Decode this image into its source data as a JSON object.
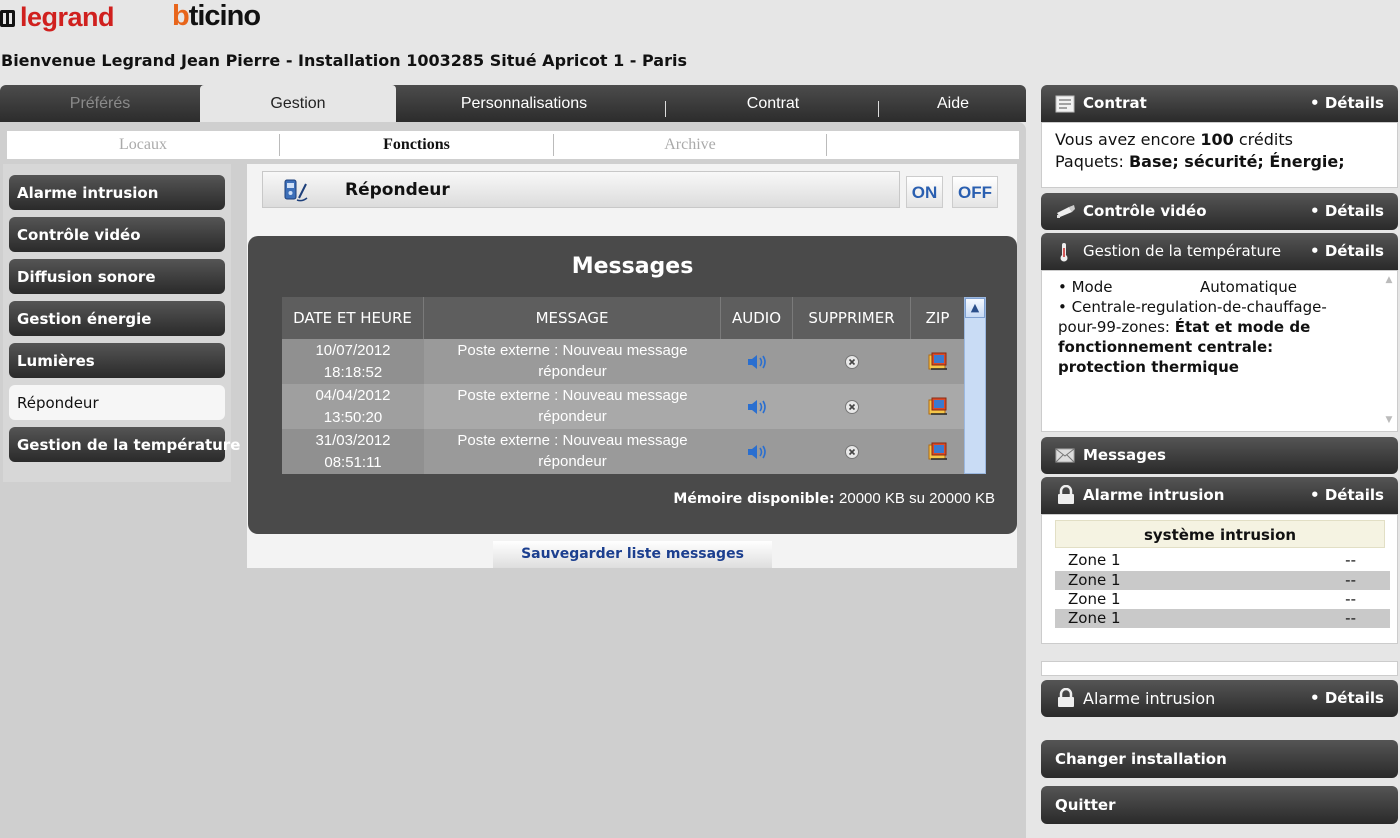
{
  "header": {
    "logo_legrand": "legrand",
    "logo_bticino": "bticino",
    "welcome": "Bienvenue Legrand Jean Pierre - Installation 1003285 Situé Apricot 1 - Paris"
  },
  "main_tabs": [
    {
      "label": "Préférés"
    },
    {
      "label": "Gestion"
    },
    {
      "label": "Personnalisations"
    },
    {
      "label": "Contrat"
    },
    {
      "label": "Aide"
    }
  ],
  "sub_tabs": [
    {
      "label": "Locaux"
    },
    {
      "label": "Fonctions"
    },
    {
      "label": "Archive"
    }
  ],
  "left_nav": [
    {
      "label": "Alarme intrusion"
    },
    {
      "label": "Contrôle vidéo"
    },
    {
      "label": "Diffusion sonore"
    },
    {
      "label": "Gestion énergie"
    },
    {
      "label": "Lumières"
    },
    {
      "label": "Répondeur"
    },
    {
      "label": "Gestion de la température"
    }
  ],
  "function_bar": {
    "title": "Répondeur",
    "on": "ON",
    "off": "OFF"
  },
  "messages": {
    "title": "Messages",
    "columns": [
      "DATE ET HEURE",
      "MESSAGE",
      "AUDIO",
      "SUPPRIMER",
      "ZIP"
    ],
    "rows": [
      {
        "date": "10/07/2012",
        "time": "18:18:52",
        "msg1": "Poste externe : Nouveau message",
        "msg2": "répondeur"
      },
      {
        "date": "04/04/2012",
        "time": "13:50:20",
        "msg1": "Poste externe : Nouveau message",
        "msg2": "répondeur"
      },
      {
        "date": "31/03/2012",
        "time": "08:51:11",
        "msg1": "Poste externe : Nouveau message",
        "msg2": "répondeur"
      }
    ],
    "memory_label": "Mémoire disponible:",
    "memory_value": "20000 KB su 20000 KB",
    "save_label": "Sauvegarder liste messages"
  },
  "right": {
    "details": "• Détails",
    "contrat": {
      "title": "Contrat",
      "line1_pre": "Vous avez encore ",
      "credits": "100",
      "line1_post": " crédits",
      "line2_pre": "Paquets: ",
      "packages": "Base; sécurité; Énergie;"
    },
    "video": {
      "title": "Contrôle vidéo"
    },
    "temperature": {
      "title": "Gestion de la température",
      "mode_label": "• Mode",
      "mode_value": "Automatique",
      "central_label": "• Centrale-regulation-de-chauffage-pour-99-zones:",
      "central_value": "État et mode de fonctionnement centrale: protection thermique"
    },
    "messages": {
      "title": "Messages"
    },
    "alarm": {
      "title": "Alarme intrusion",
      "system": "système intrusion",
      "zones": [
        {
          "name": "Zone 1",
          "value": "--"
        },
        {
          "name": "Zone 1",
          "value": "--"
        },
        {
          "name": "Zone 1",
          "value": "--"
        },
        {
          "name": "Zone 1",
          "value": "--"
        }
      ]
    },
    "alarm2": {
      "title": "Alarme intrusion"
    },
    "change_installation": "Changer installation",
    "quit": "Quitter"
  },
  "colors": {
    "accent_blue": "#2a5fb0",
    "logo_red": "#d0201e",
    "logo_orange": "#e8651b",
    "dark_bar": "#3a3a3a"
  }
}
